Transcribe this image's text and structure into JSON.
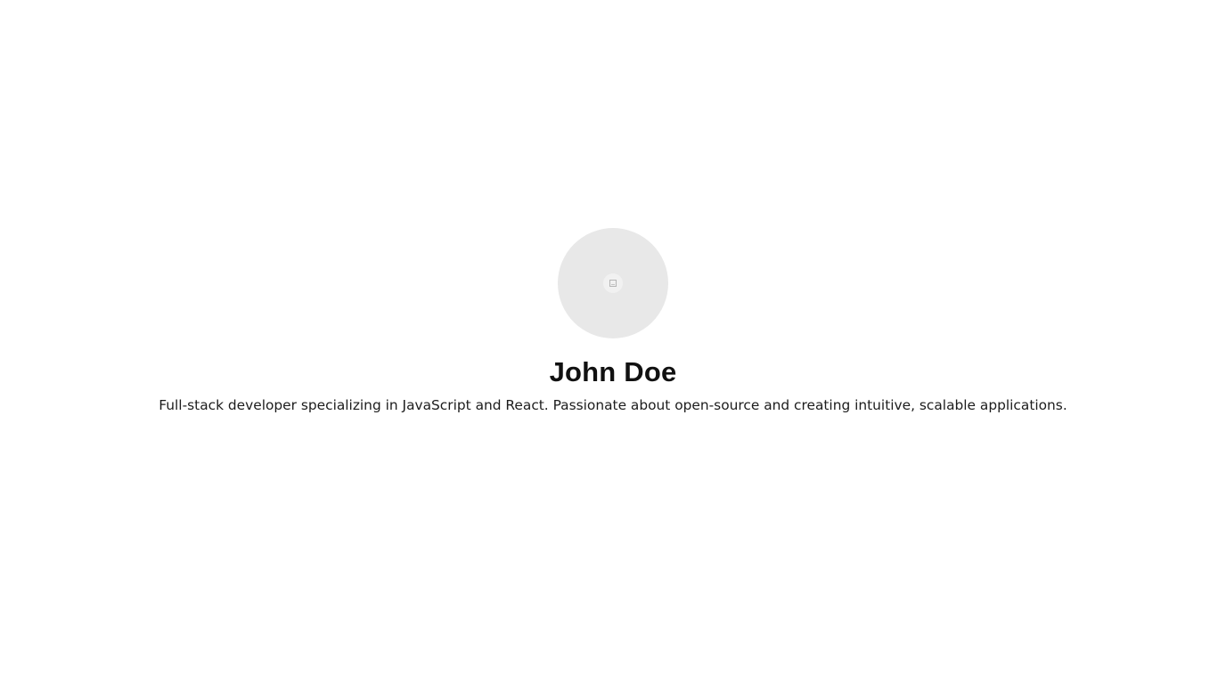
{
  "profile": {
    "avatar_icon": "broken-image-icon",
    "name": "John Doe",
    "bio": "Full-stack developer specializing in JavaScript and React. Passionate about open-source and creating intuitive, scalable applications."
  },
  "colors": {
    "background": "#ffffff",
    "avatar_background": "#e8e8e8",
    "text_primary": "#111111"
  }
}
